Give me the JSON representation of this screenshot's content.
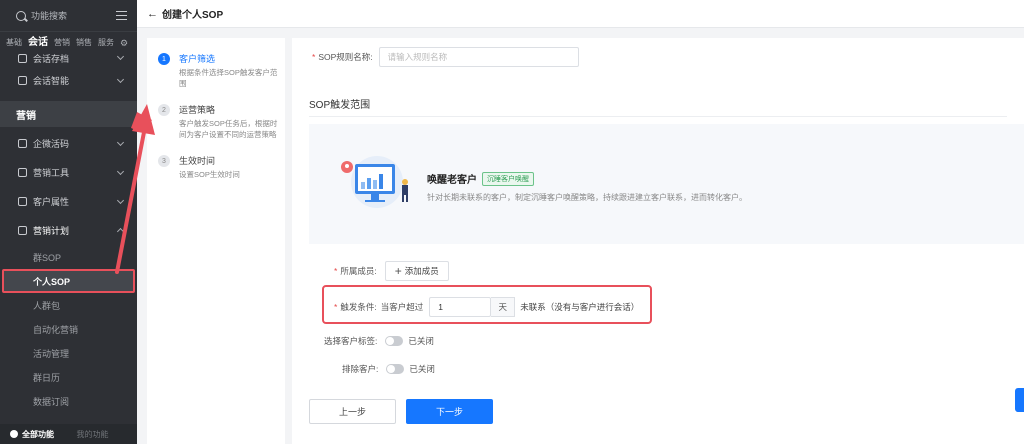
{
  "sidebar": {
    "search_placeholder": "功能搜索",
    "tabs": [
      "基础",
      "会话",
      "营销",
      "销售",
      "服务"
    ],
    "active_tab": "会话",
    "items_top": [
      {
        "label": "会话存档"
      },
      {
        "label": "会话智能"
      }
    ],
    "section": "营销",
    "items": [
      {
        "label": "企微活码"
      },
      {
        "label": "营销工具"
      },
      {
        "label": "客户属性"
      },
      {
        "label": "营销计划"
      }
    ],
    "sub_items": [
      "群SOP",
      "个人SOP",
      "人群包",
      "自动化营销",
      "活动管理",
      "群日历",
      "数据订阅"
    ],
    "selected_sub": "个人SOP",
    "footer": {
      "all": "全部功能",
      "mine": "我的功能"
    }
  },
  "topbar": {
    "back_icon": "←",
    "title": "创建个人SOP"
  },
  "steps": [
    {
      "num": "1",
      "title": "客户筛选",
      "desc": "根据条件选择SOP触发客户范围"
    },
    {
      "num": "2",
      "title": "运营策略",
      "desc": "客户触发SOP任务后，根据时间为客户设置不同的运营策略"
    },
    {
      "num": "3",
      "title": "生效时间",
      "desc": "设置SOP生效时间"
    }
  ],
  "form": {
    "name_label": "SOP规则名称:",
    "name_placeholder": "请输入规则名称",
    "range_heading": "SOP触发范围",
    "card": {
      "title": "唤醒老客户",
      "badge": "沉睡客户唤醒",
      "desc": "针对长期未联系的客户，制定沉睡客户唤醒策略，持续跟进建立客户联系，进而转化客户。"
    },
    "member_label": "所属成员:",
    "add_member": "添加成员",
    "trigger_label": "触发条件:",
    "trigger_prefix": "当客户超过",
    "trigger_value": "1",
    "trigger_unit": "天",
    "trigger_suffix": "未联系（没有与客户进行会话）",
    "tag_label": "选择客户标签:",
    "tag_state": "已关闭",
    "exclude_label": "排除客户:",
    "exclude_state": "已关闭",
    "prev": "上一步",
    "next": "下一步"
  },
  "colors": {
    "accent": "#1677ff",
    "highlight": "#e8505b",
    "sidebar": "#2e3035"
  }
}
